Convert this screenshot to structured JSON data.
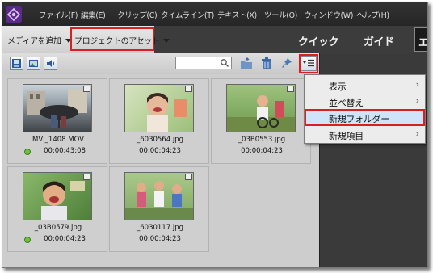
{
  "menubar": {
    "items": [
      "ファイル(F)",
      "編集(E)",
      "クリップ(C)",
      "タイムライン(T)",
      "テキスト(X)",
      "ツール(O)",
      "ウィンドウ(W)",
      "ヘルプ(H)"
    ]
  },
  "toolbar": {
    "add_media": "メディアを追加",
    "project_assets": "プロジェクトのアセット",
    "mode_quick": "クイック",
    "mode_guide": "ガイド",
    "mode_expert": "エ"
  },
  "search": {
    "value": ""
  },
  "assets": [
    {
      "name": "MVI_1408.MOV",
      "duration": "00:00:43:08",
      "type": "video",
      "used": true
    },
    {
      "name": "_6030564.jpg",
      "duration": "00:00:04:23",
      "type": "image",
      "used": false
    },
    {
      "name": "_03B0553.jpg",
      "duration": "00:00:04:23",
      "type": "image",
      "used": false
    },
    {
      "name": "_03B0579.jpg",
      "duration": "00:00:04:23",
      "type": "image",
      "used": true
    },
    {
      "name": "_6030117.jpg",
      "duration": "00:00:04:23",
      "type": "image",
      "used": false
    }
  ],
  "panel_menu": {
    "items": [
      {
        "label": "表示",
        "has_submenu": true,
        "selected": false
      },
      {
        "label": "並べ替え",
        "has_submenu": true,
        "selected": false
      },
      {
        "label": "新規フォルダー",
        "has_submenu": false,
        "selected": true
      },
      {
        "label": "新規項目",
        "has_submenu": true,
        "selected": false
      }
    ]
  },
  "icons": {
    "logo": "premiere-elements-logo-icon",
    "filter_video": "film-icon",
    "filter_image": "photo-icon",
    "filter_audio": "speaker-icon",
    "search": "magnifier-icon",
    "new_folder": "folder-up-icon",
    "trash": "trash-icon",
    "pin": "pin-icon",
    "panel_menu": "menu-list-icon",
    "submenu_arrow": "chevron-right-icon"
  },
  "colors": {
    "highlight_box": "#d82020",
    "menu_selected_bg": "#cfe4f8",
    "used_dot": "#6bc23a",
    "dark_chrome": "#3c3c3c"
  }
}
